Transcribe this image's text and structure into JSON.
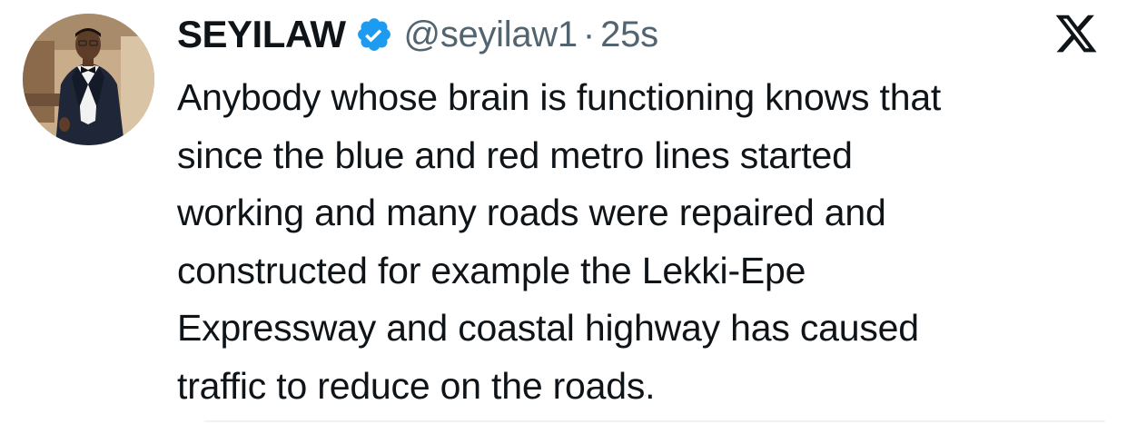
{
  "tweet": {
    "author": {
      "display_name": "SEYILAW",
      "handle": "@seyilaw1",
      "verified": true,
      "verified_badge_color": "#1d9bf0",
      "avatar_icon": "profile-photo-man-in-tuxedo"
    },
    "separator": "·",
    "time_ago": "25s",
    "platform_icon": "x-logo-icon",
    "text": "Anybody whose brain is functioning knows that\nsince the blue and red metro lines started\nworking and many roads were repaired and\nconstructed for example the Lekki-Epe\nExpressway and coastal highway has caused\ntraffic to reduce on the roads."
  },
  "colors": {
    "text_primary": "#0f1419",
    "text_secondary": "#536471",
    "accent": "#1d9bf0",
    "divider": "#eff3f4"
  }
}
